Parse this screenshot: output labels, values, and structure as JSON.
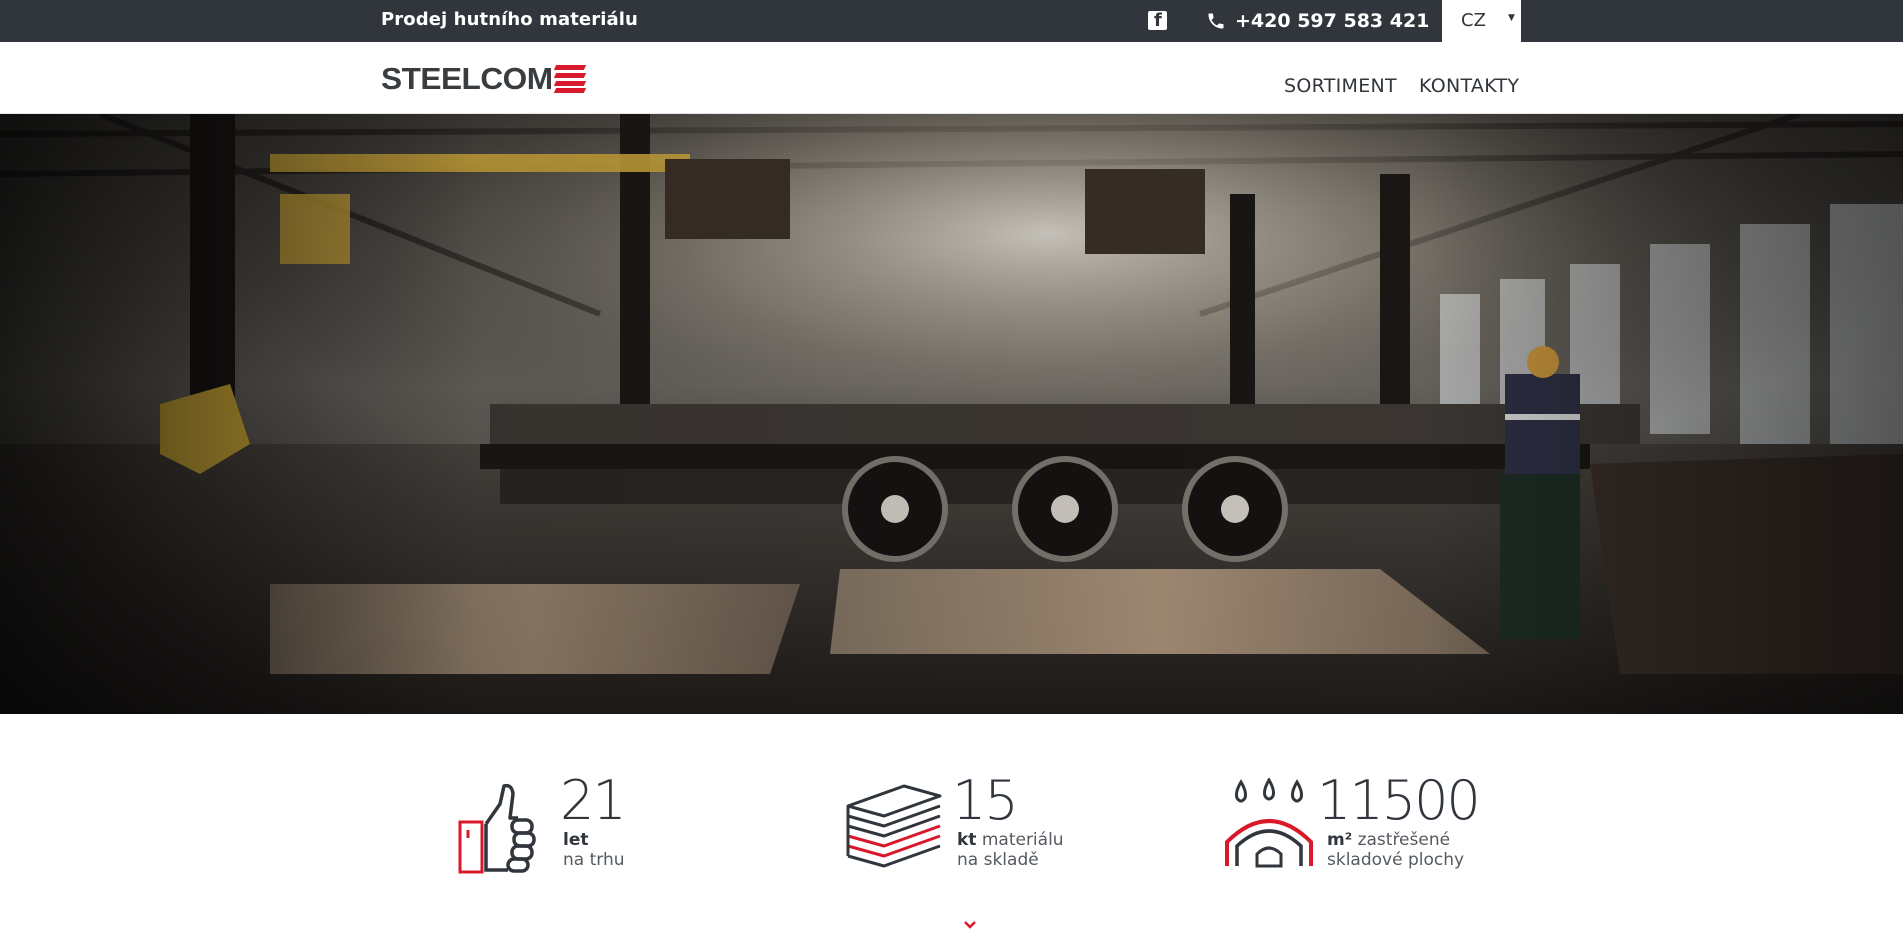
{
  "topbar": {
    "tagline": "Prodej hutního materiálu",
    "facebook_icon": "facebook-icon",
    "phone_icon": "phone-icon",
    "phone": "+420 597 583 421",
    "language": "CZ"
  },
  "header": {
    "logo_text": "STEELCOM",
    "nav": [
      "SORTIMENT",
      "KONTAKTY"
    ]
  },
  "hero": {
    "image": "steel warehouse with truck trailer and steel plates"
  },
  "stats": [
    {
      "icon": "thumbs-up-icon",
      "value": "21",
      "unit": "let",
      "line1_rest": "",
      "line2": "na trhu"
    },
    {
      "icon": "steel-sheets-icon",
      "value": "15",
      "unit": "kt",
      "line1_rest": " materiálu",
      "line2": "na skladě"
    },
    {
      "icon": "covered-storage-icon",
      "value": "11500",
      "unit": "m²",
      "line1_rest": " zastřešené",
      "line2": "skladové plochy"
    }
  ],
  "colors": {
    "topbar_bg": "#30363c",
    "accent": "#d8192b",
    "text_dark": "#30363c"
  }
}
